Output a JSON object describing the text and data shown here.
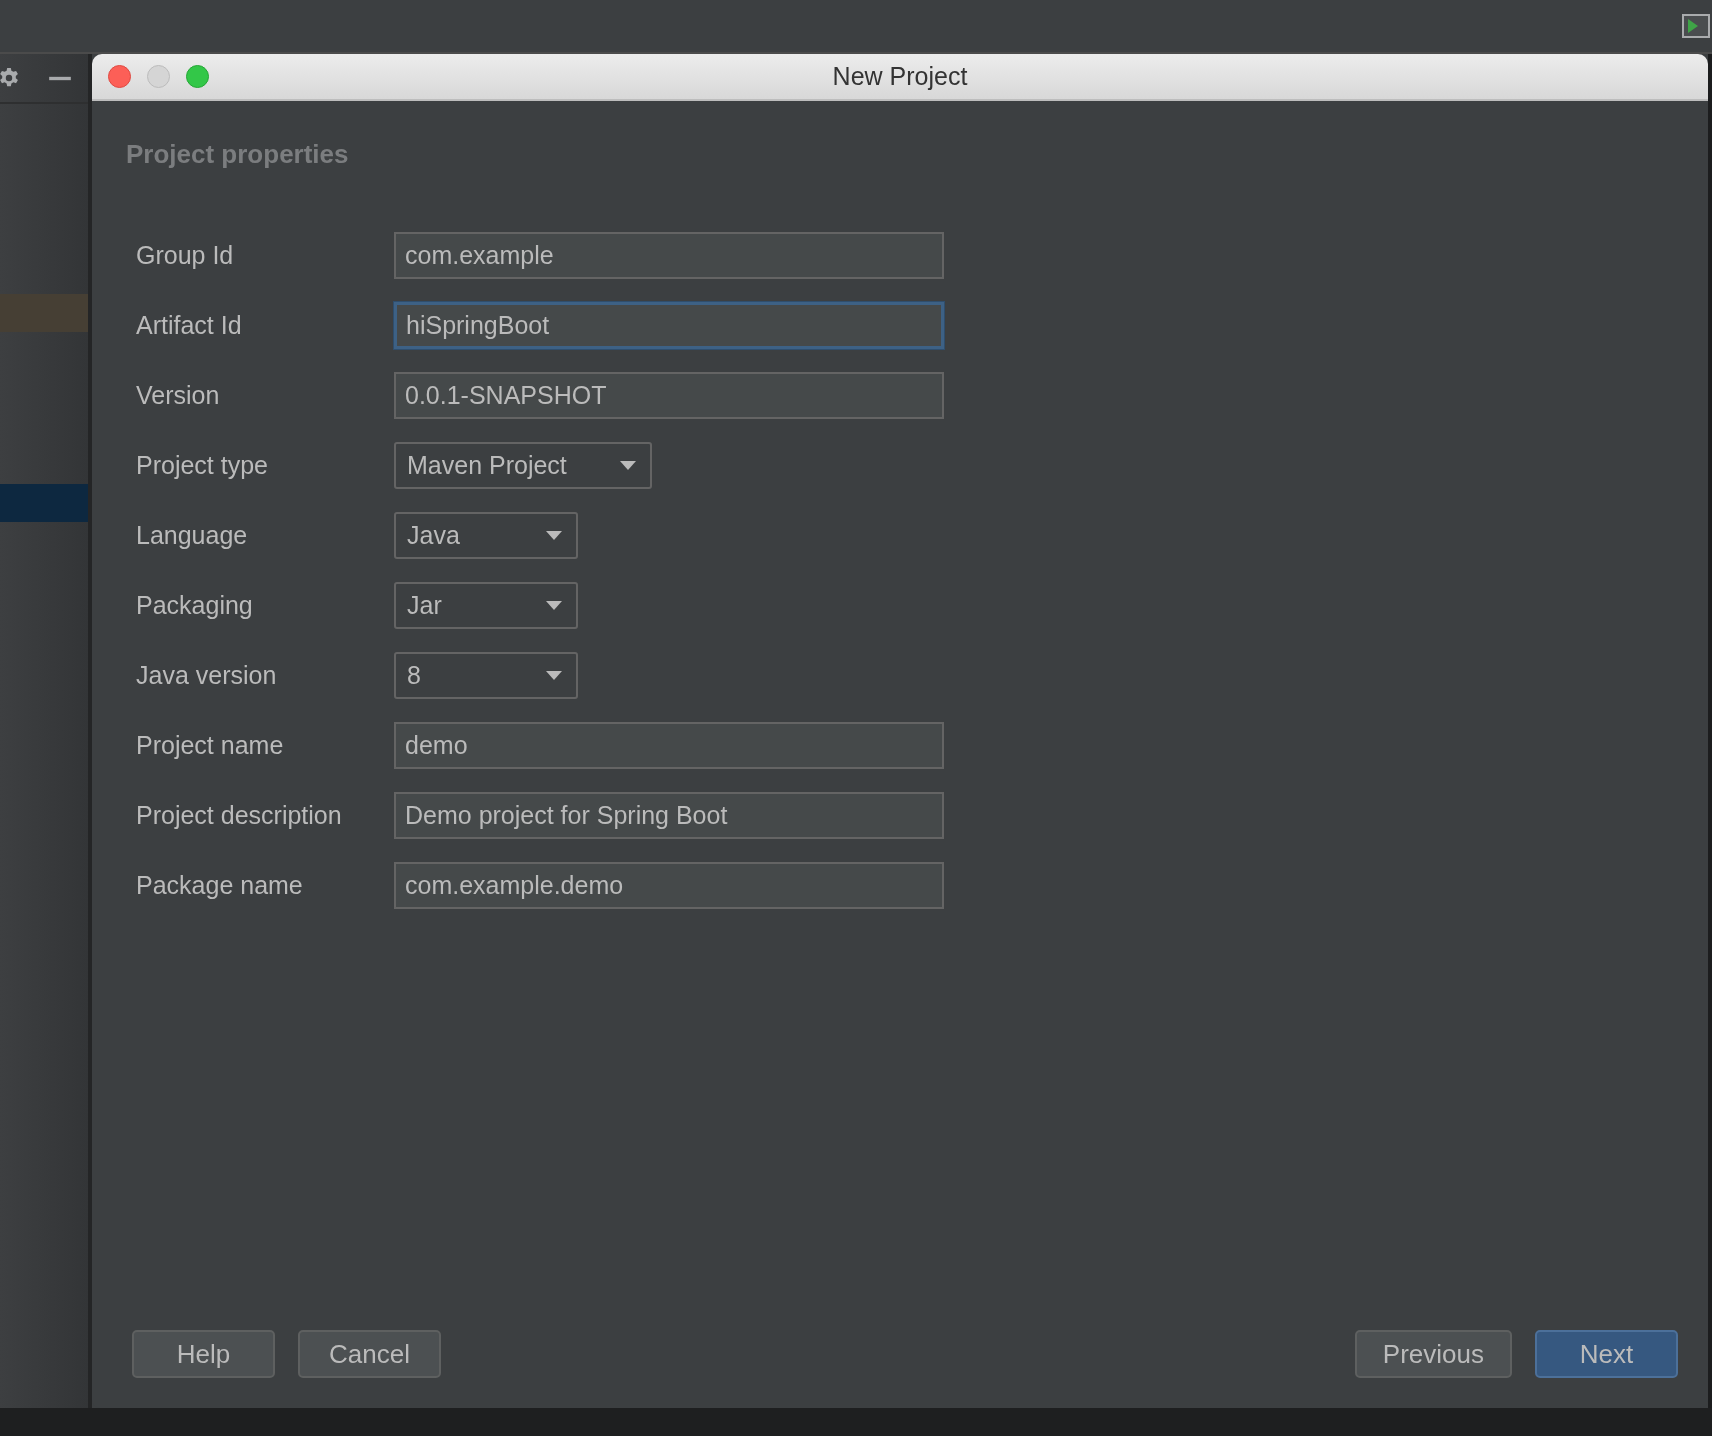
{
  "window": {
    "title": "New Project"
  },
  "section_title": "Project properties",
  "fields": [
    {
      "label": "Group Id",
      "kind": "text",
      "value": "com.example",
      "focused": false
    },
    {
      "label": "Artifact Id",
      "kind": "text",
      "value": "hiSpringBoot",
      "focused": true
    },
    {
      "label": "Version",
      "kind": "text",
      "value": "0.0.1-SNAPSHOT",
      "focused": false
    },
    {
      "label": "Project type",
      "kind": "dropdown",
      "value": "Maven Project",
      "focused": false
    },
    {
      "label": "Language",
      "kind": "dropdown",
      "value": "Java",
      "focused": false
    },
    {
      "label": "Packaging",
      "kind": "dropdown",
      "value": "Jar",
      "focused": false
    },
    {
      "label": "Java version",
      "kind": "dropdown",
      "value": "8",
      "focused": false
    },
    {
      "label": "Project name",
      "kind": "text",
      "value": "demo",
      "focused": false
    },
    {
      "label": "Project description",
      "kind": "text",
      "value": "Demo project for Spring Boot",
      "focused": false
    },
    {
      "label": "Package name",
      "kind": "text",
      "value": "com.example.demo",
      "focused": false
    }
  ],
  "buttons_left": [
    {
      "label": "Help",
      "primary": false
    },
    {
      "label": "Cancel",
      "primary": false
    }
  ],
  "buttons_right": [
    {
      "label": "Previous",
      "primary": false
    },
    {
      "label": "Next",
      "primary": true
    }
  ]
}
